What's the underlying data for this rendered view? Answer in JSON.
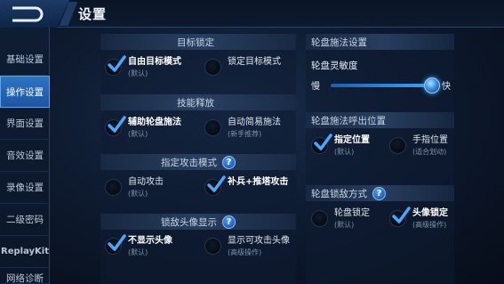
{
  "header": {
    "title": "设置"
  },
  "sidebar": {
    "items": [
      {
        "label": "基础设置"
      },
      {
        "label": "操作设置"
      },
      {
        "label": "界面设置"
      },
      {
        "label": "音效设置"
      },
      {
        "label": "录像设置"
      },
      {
        "label": "二级密码"
      },
      {
        "label": "ReplayKit"
      },
      {
        "label": "网络诊断"
      }
    ],
    "active_index": 1
  },
  "left": {
    "target_lock": {
      "title": "目标锁定",
      "options": [
        {
          "label": "自由目标模式",
          "sub": "(默认)",
          "selected": true
        },
        {
          "label": "锁定目标模式",
          "sub": "",
          "selected": false
        }
      ]
    },
    "skill_cast": {
      "title": "技能释放",
      "options": [
        {
          "label": "辅助轮盘施法",
          "sub": "(默认)",
          "selected": true
        },
        {
          "label": "自动简易施法",
          "sub": "(新手推荐)",
          "selected": false
        }
      ]
    },
    "attack_mode": {
      "title": "指定攻击模式",
      "options": [
        {
          "label": "自动攻击",
          "sub": "(默认)",
          "selected": false
        },
        {
          "label": "补兵+推塔攻击",
          "sub": "",
          "selected": true
        }
      ]
    },
    "lock_avatar": {
      "title": "锁敌头像显示",
      "options": [
        {
          "label": "不显示头像",
          "sub": "(默认)",
          "selected": true
        },
        {
          "label": "显示可攻击头像",
          "sub": "(高级操作)",
          "selected": false
        }
      ]
    }
  },
  "right": {
    "wheel_cast": {
      "title": "轮盘施法设置",
      "sensitivity_label": "轮盘灵敏度",
      "slow_label": "慢",
      "fast_label": "快",
      "sensitivity_value": 0.96
    },
    "wheel_position": {
      "title": "轮盘施法呼出位置",
      "options": [
        {
          "label": "指定位置",
          "sub": "(默认)",
          "selected": true
        },
        {
          "label": "手指位置",
          "sub": "(适合划动)",
          "selected": false
        }
      ]
    },
    "wheel_lock": {
      "title": "轮盘锁敌方式",
      "options": [
        {
          "label": "轮盘锁定",
          "sub": "(默认)",
          "selected": false
        },
        {
          "label": "头像锁定",
          "sub": "(高级操作)",
          "selected": true
        }
      ]
    }
  },
  "help_glyph": "?",
  "colors": {
    "accent": "#3ea2ff",
    "active_tab": "#2e73c4",
    "checkmark": "#4aa6ff"
  }
}
